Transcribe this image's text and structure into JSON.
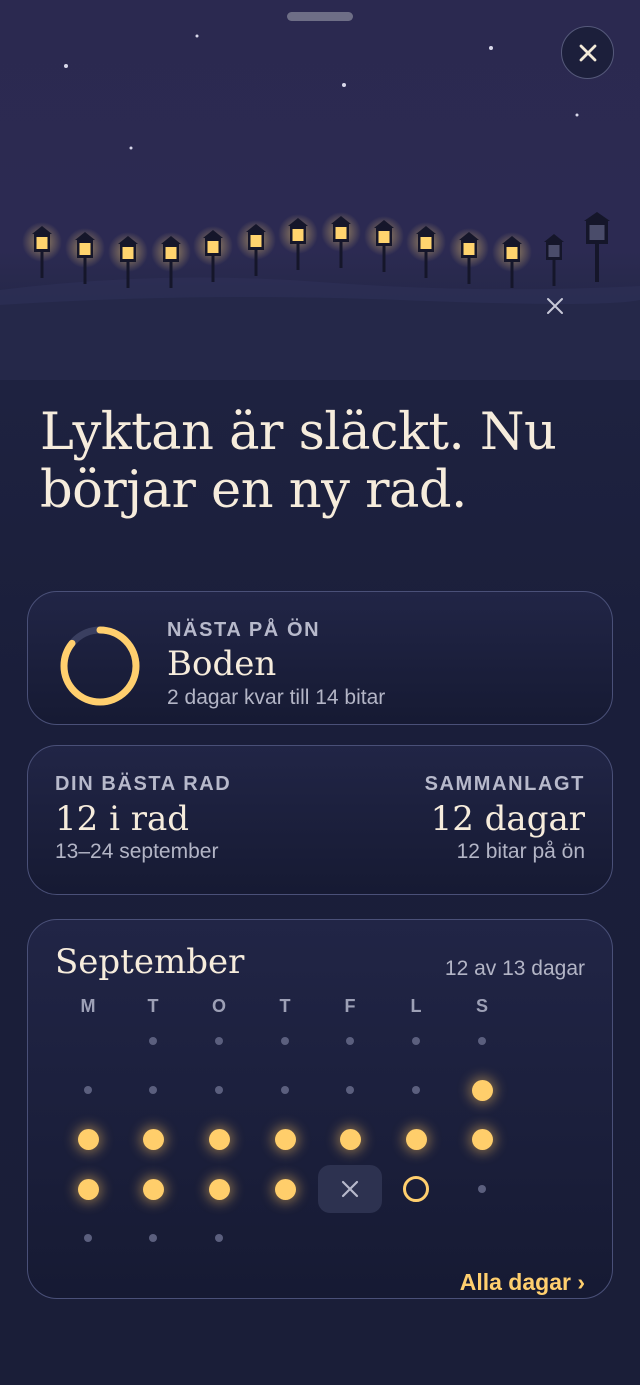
{
  "sheet": {
    "close_icon": "close-icon",
    "scene_close_icon": "close-icon"
  },
  "headline": {
    "line1": "Lyktan är släckt. Nu",
    "line2": "börjar en ny rad."
  },
  "next_card": {
    "eyebrow": "NÄSTA PÅ ÖN",
    "title": "Boden",
    "subtitle": "2 dagar kvar till 14 bitar",
    "progress": 0.857
  },
  "stats_card": {
    "best_label": "DIN BÄSTA RAD",
    "best_value": "12 i rad",
    "best_dates": "13–24 september",
    "total_label": "SAMMANLAGT",
    "total_value": "12 dagar",
    "total_sub": "12 bitar på ön"
  },
  "calendar": {
    "month": "September",
    "count": "12 av 13 dagar",
    "weekdays": [
      "M",
      "T",
      "O",
      "T",
      "F",
      "L",
      "S"
    ],
    "weeks": [
      [
        "none",
        "empty",
        "empty",
        "empty",
        "empty",
        "empty",
        "empty"
      ],
      [
        "empty",
        "empty",
        "empty",
        "empty",
        "empty",
        "empty",
        "lit"
      ],
      [
        "lit",
        "lit",
        "lit",
        "lit",
        "lit",
        "lit",
        "lit"
      ],
      [
        "lit",
        "lit",
        "lit",
        "lit",
        "missed",
        "today",
        "empty"
      ],
      [
        "empty",
        "empty",
        "empty",
        "none",
        "none",
        "none",
        "none"
      ]
    ],
    "all_days": "Alla dagar ›"
  },
  "colors": {
    "accent": "#ffcf6e",
    "background": "#1b1f3a",
    "card_border": "#4a5078"
  }
}
